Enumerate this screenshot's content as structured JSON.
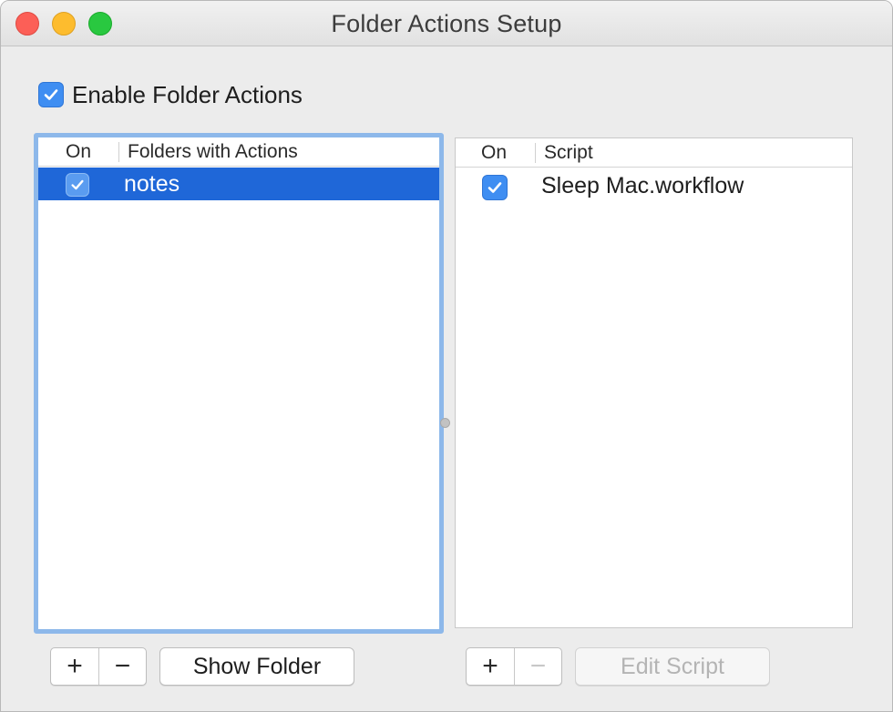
{
  "window": {
    "title": "Folder Actions Setup"
  },
  "enable_checkbox": {
    "label": "Enable Folder Actions",
    "checked": true
  },
  "folders_table": {
    "headers": [
      "On",
      "Folders with Actions"
    ],
    "rows": [
      {
        "on": true,
        "name": "notes",
        "selected": true
      }
    ]
  },
  "scripts_table": {
    "headers": [
      "On",
      "Script"
    ],
    "rows": [
      {
        "on": true,
        "name": "Sleep Mac.workflow",
        "selected": false
      }
    ]
  },
  "folder_controls": {
    "add": "+",
    "remove": "−",
    "show_folder": "Show Folder"
  },
  "script_controls": {
    "add": "+",
    "remove": "−",
    "edit_script": "Edit Script"
  },
  "colors": {
    "selection": "#1f67d8",
    "checkbox": "#3f8ef2",
    "focus_ring": "#8db8ea"
  }
}
